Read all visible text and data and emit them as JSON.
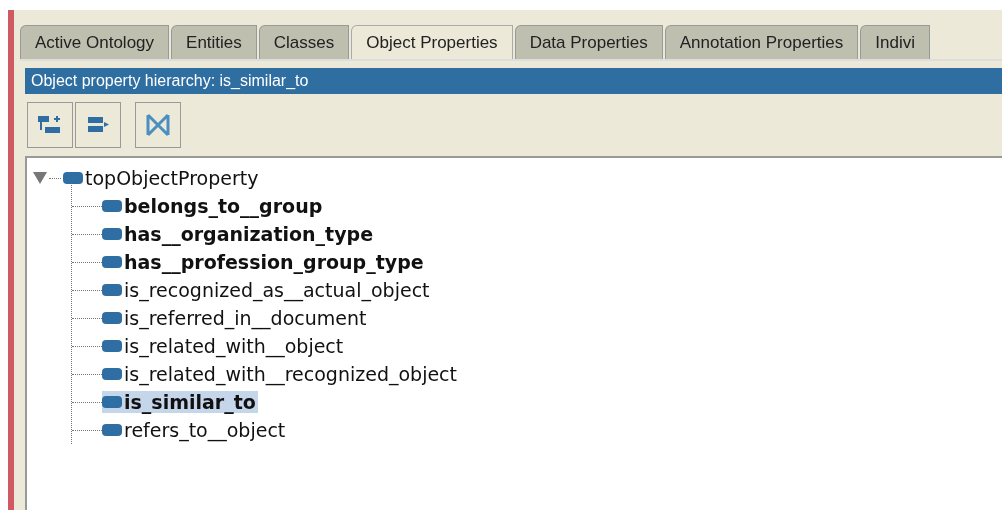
{
  "tabs": [
    {
      "label": "Active Ontology",
      "selected": false
    },
    {
      "label": "Entities",
      "selected": false
    },
    {
      "label": "Classes",
      "selected": false
    },
    {
      "label": "Object Properties",
      "selected": true
    },
    {
      "label": "Data Properties",
      "selected": false
    },
    {
      "label": "Annotation Properties",
      "selected": false
    },
    {
      "label": "Indivi",
      "selected": false
    }
  ],
  "panel": {
    "title": "Object property hierarchy: is_similar_to"
  },
  "toolbar": [
    {
      "kind": "add-sub"
    },
    {
      "kind": "add-sibling"
    },
    {
      "kind": "delete"
    }
  ],
  "tree": {
    "label": "topObjectProperty",
    "expanded": true,
    "bold": false,
    "selected": false,
    "children": [
      {
        "label": "belongs_to__group",
        "bold": true,
        "selected": false
      },
      {
        "label": "has__organization_type",
        "bold": true,
        "selected": false
      },
      {
        "label": "has__profession_group_type",
        "bold": true,
        "selected": false
      },
      {
        "label": "is_recognized_as__actual_object",
        "bold": false,
        "selected": false
      },
      {
        "label": "is_referred_in__document",
        "bold": false,
        "selected": false
      },
      {
        "label": "is_related_with__object",
        "bold": false,
        "selected": false
      },
      {
        "label": "is_related_with__recognized_object",
        "bold": false,
        "selected": false
      },
      {
        "label": "is_similar_to",
        "bold": true,
        "selected": true
      },
      {
        "label": "refers_to__object",
        "bold": false,
        "selected": false
      }
    ]
  }
}
